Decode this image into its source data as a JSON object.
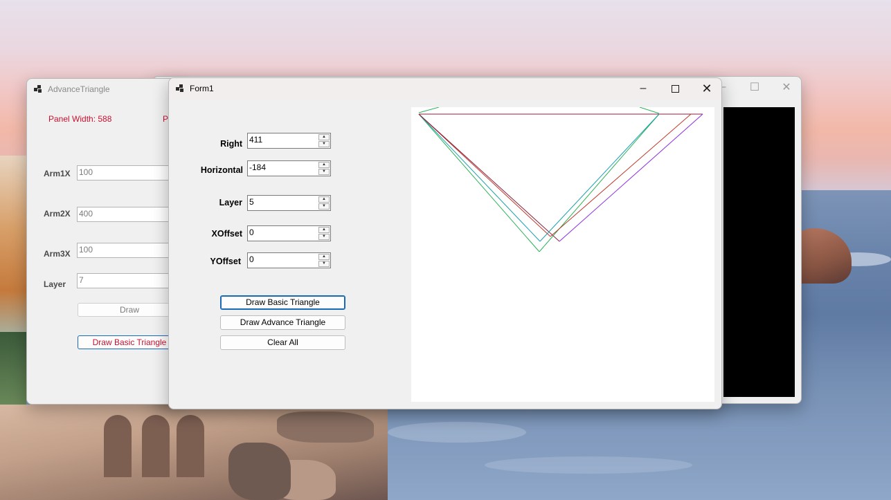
{
  "adv_window": {
    "title": "AdvanceTriangle",
    "panel_width_label": "Panel Width: 588",
    "panel_second_label_fragment": "P",
    "fields": [
      {
        "label": "Arm1X",
        "value": "100"
      },
      {
        "label": "Arm2X",
        "value": "400"
      },
      {
        "label": "Arm3X",
        "value": "100"
      },
      {
        "label": "Layer",
        "value": "7"
      }
    ],
    "draw_button": "Draw",
    "draw_basic_button": "Draw Basic Triangle"
  },
  "form1": {
    "title": "Form1",
    "fields": [
      {
        "label": "Right",
        "value": "411"
      },
      {
        "label": "Horizontal",
        "value": "-184"
      },
      {
        "label": "Layer",
        "value": "5"
      },
      {
        "label": "XOffset",
        "value": "0"
      },
      {
        "label": "YOffset",
        "value": "0"
      }
    ],
    "buttons": {
      "draw_basic": "Draw Basic Triangle",
      "draw_advance": "Draw Advance Triangle",
      "clear_all": "Clear All"
    }
  },
  "colors": {
    "accent_red": "#c8102e",
    "focus_blue": "#1868b8",
    "line_red": "#c0392b",
    "line_purple": "#8a2be2",
    "line_teal": "#1aa0b0",
    "line_green": "#2db35a",
    "line_maroon": "#9b2340"
  }
}
